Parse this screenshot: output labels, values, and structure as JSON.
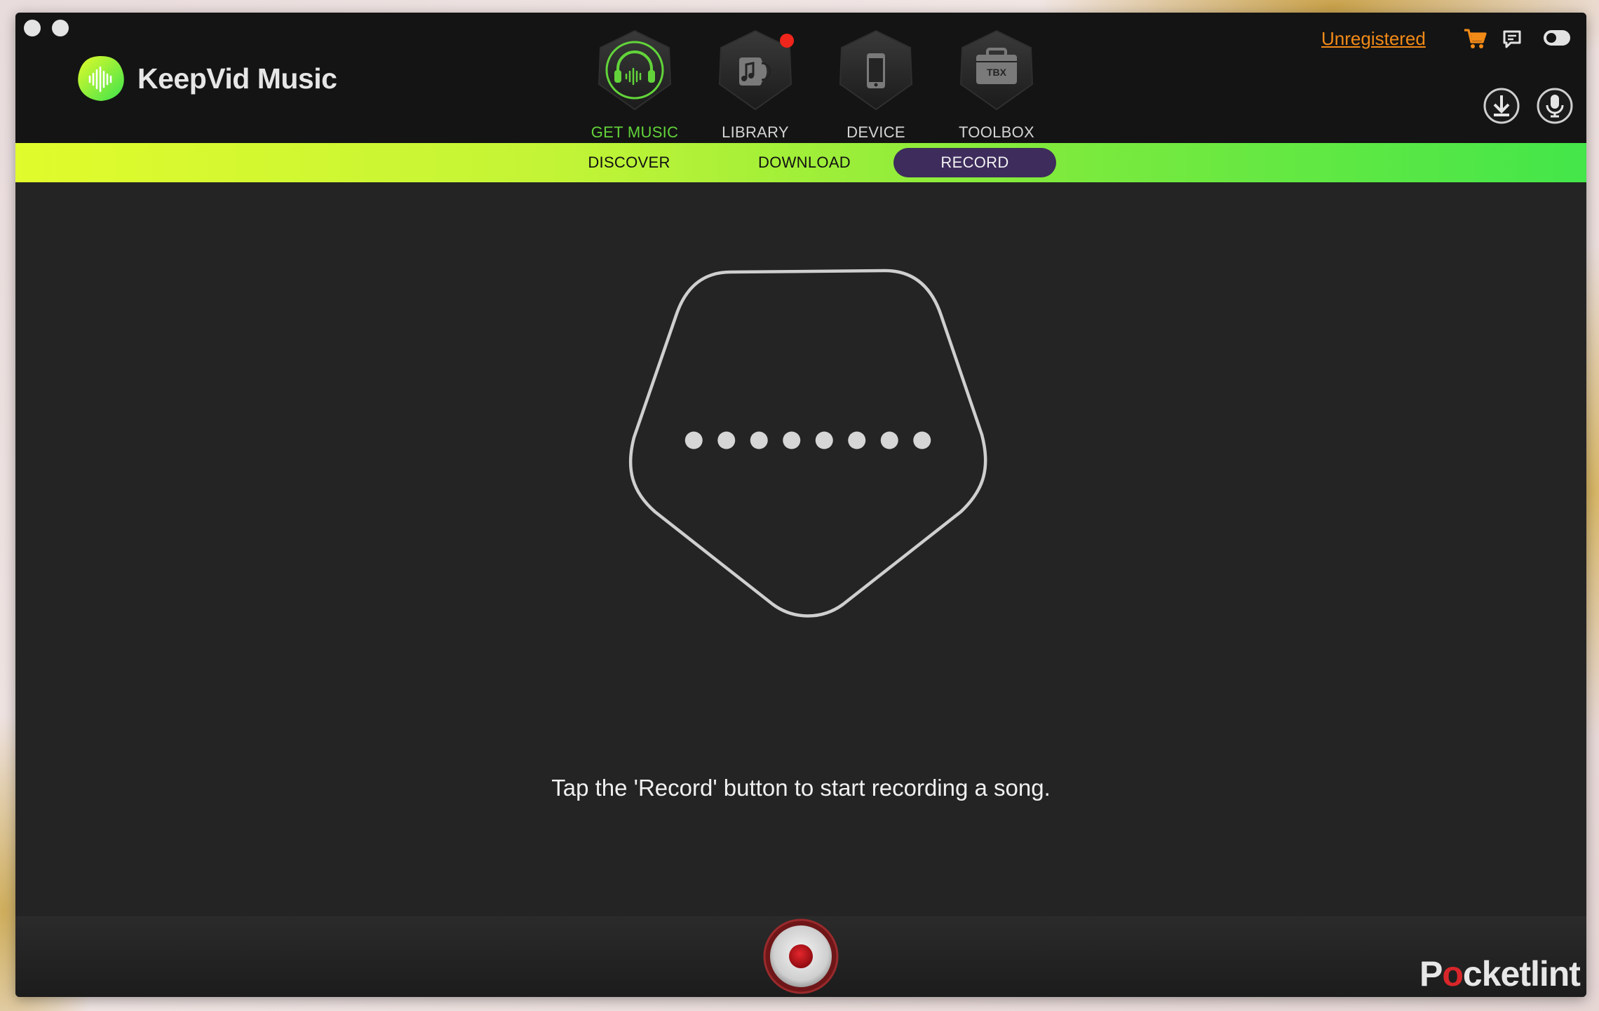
{
  "app": {
    "name": "KeepVid Music"
  },
  "nav": {
    "tabs": [
      {
        "label": "GET MUSIC",
        "icon": "headphones-icon",
        "active": true
      },
      {
        "label": "LIBRARY",
        "icon": "library-icon",
        "active": false,
        "notification": true
      },
      {
        "label": "DEVICE",
        "icon": "phone-icon",
        "active": false
      },
      {
        "label": "TOOLBOX",
        "icon": "toolbox-icon",
        "active": false,
        "icon_text": "TBX"
      }
    ]
  },
  "header": {
    "unregistered_label": "Unregistered",
    "icons": [
      "cart-icon",
      "feedback-icon",
      "toggle-icon",
      "download-circle-icon",
      "microphone-circle-icon"
    ]
  },
  "subnav": {
    "tabs": [
      {
        "label": "DISCOVER",
        "active": false
      },
      {
        "label": "DOWNLOAD",
        "active": false
      },
      {
        "label": "RECORD",
        "active": true
      }
    ]
  },
  "main": {
    "visualizer_dot_count": 8,
    "hint": "Tap the 'Record' button to start recording a song."
  },
  "footer": {
    "record_button_icon": "record-icon"
  },
  "watermark": {
    "prefix": "P",
    "o": "o",
    "suffix": "cketlint"
  },
  "colors": {
    "accent_green": "#62d43a",
    "notification_red": "#f0251b",
    "link_orange": "#f28a18",
    "active_subtab": "#3d2c5c",
    "record_red": "#c2121a"
  }
}
